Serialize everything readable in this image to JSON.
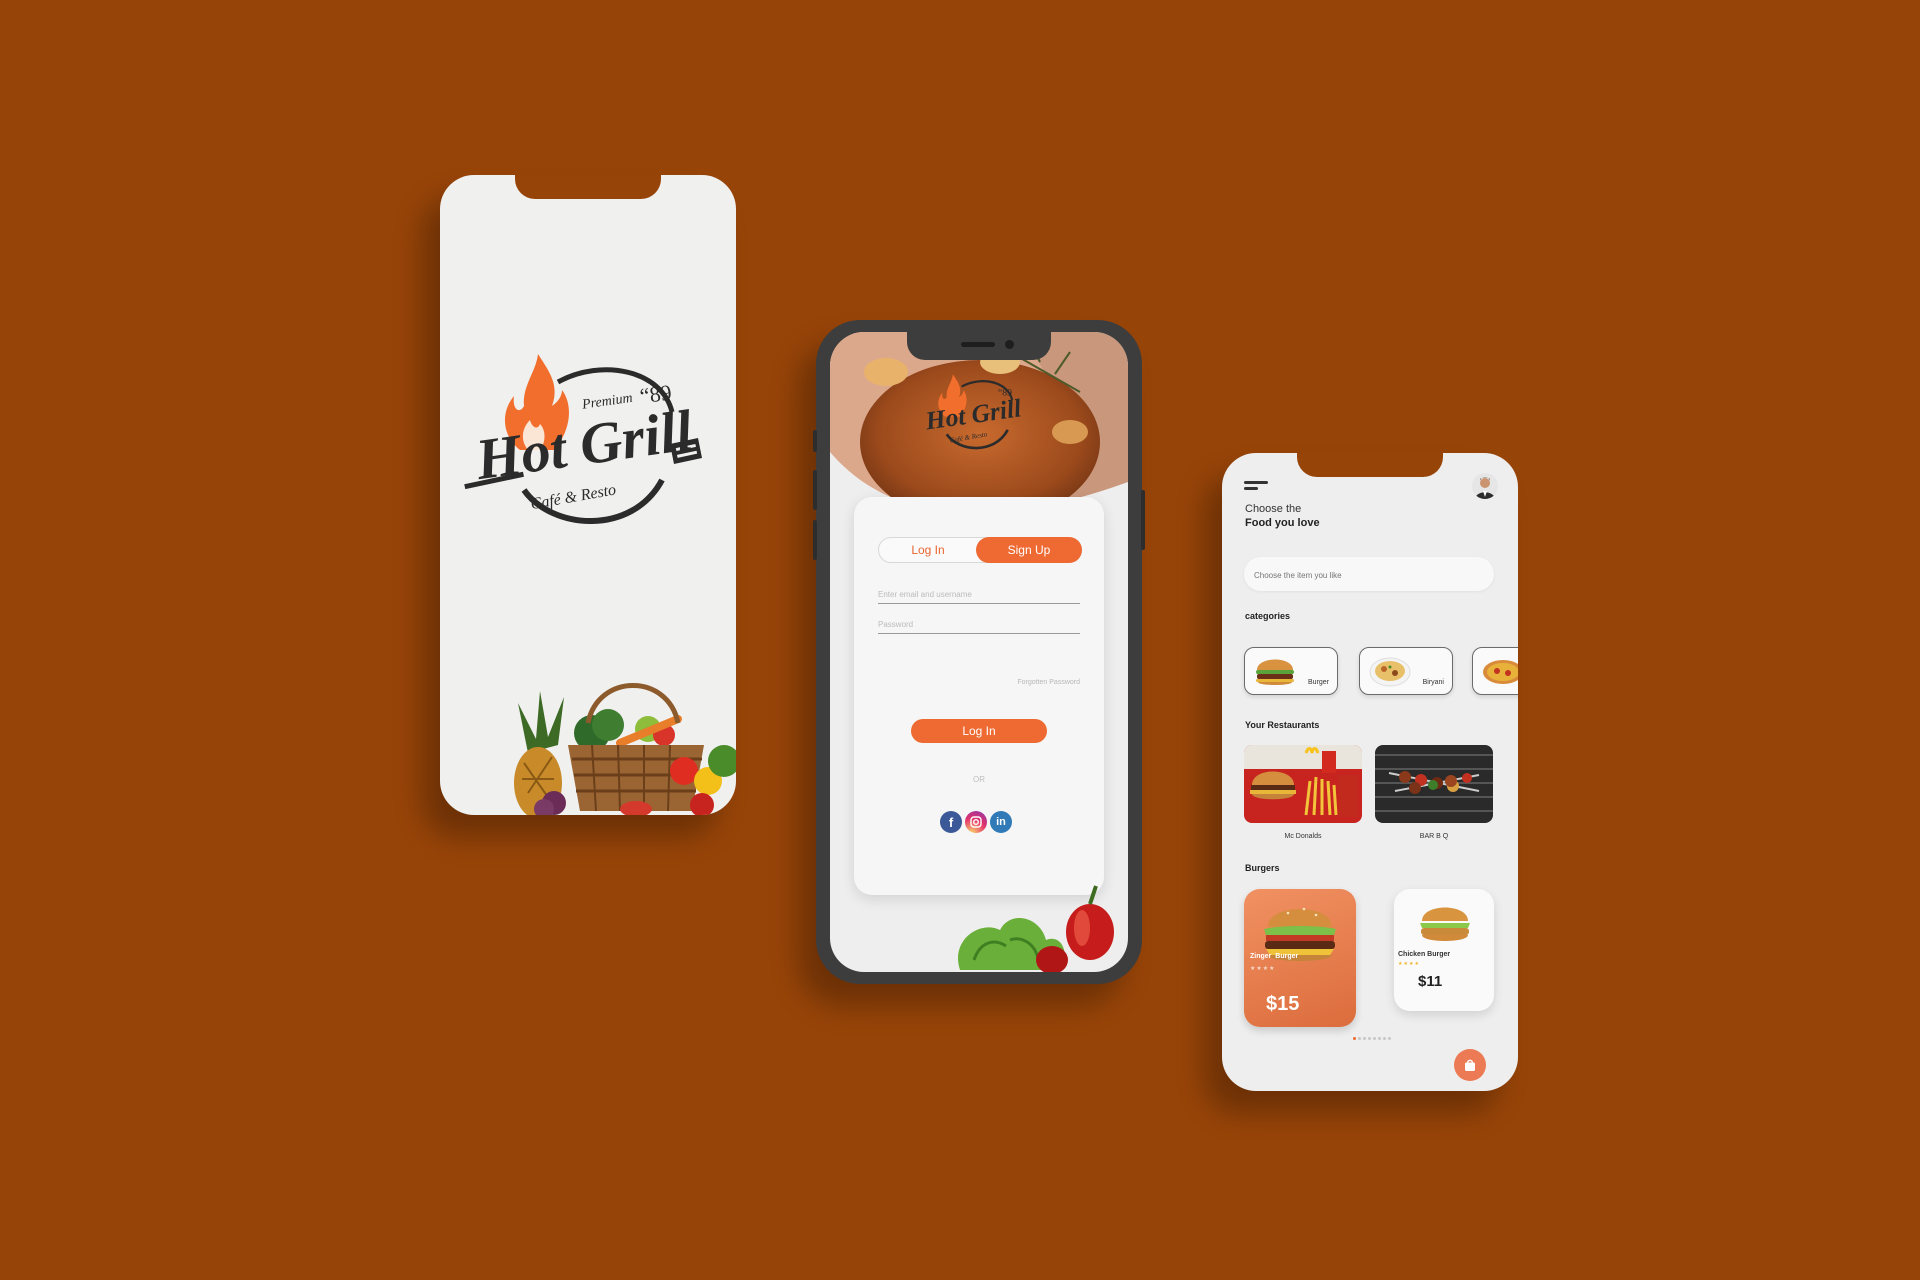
{
  "brand": {
    "premium": "Premium",
    "year": "“89",
    "name": "Hot Grill",
    "tagline": "Café & Resto",
    "accent_color": "#ee6a32",
    "background_color": "#974408"
  },
  "login": {
    "tab_login": "Log In",
    "tab_signup": "Sign Up",
    "active_tab": "Sign Up",
    "email_placeholder": "Enter email and username",
    "password_placeholder": "Password",
    "forgot": "Forgotten Password",
    "submit": "Log In",
    "or": "OR",
    "socials": [
      "facebook-icon",
      "instagram-icon",
      "linkedin-icon"
    ]
  },
  "home": {
    "greeting_line1": "Choose the",
    "greeting_line2": "Food you love",
    "search_placeholder": "Choose the item you like",
    "categories_title": "categories",
    "categories": [
      {
        "label": "Burger",
        "icon": "burger-icon"
      },
      {
        "label": "Biryani",
        "icon": "biryani-icon"
      },
      {
        "label": "",
        "icon": "pizza-icon"
      }
    ],
    "restaurants_title": "Your Restaurants",
    "restaurants": [
      {
        "name": "Mc Donalds"
      },
      {
        "name": "BAR B Q"
      }
    ],
    "burgers_title": "Burgers",
    "burgers": [
      {
        "name": "Zinger  Burger",
        "price": "$15",
        "rating": 4
      },
      {
        "name": "Chicken Burger",
        "price": "$11",
        "rating": 4
      }
    ],
    "carousel_active_dot": 1,
    "cart_icon": "shopping-bag-icon"
  }
}
